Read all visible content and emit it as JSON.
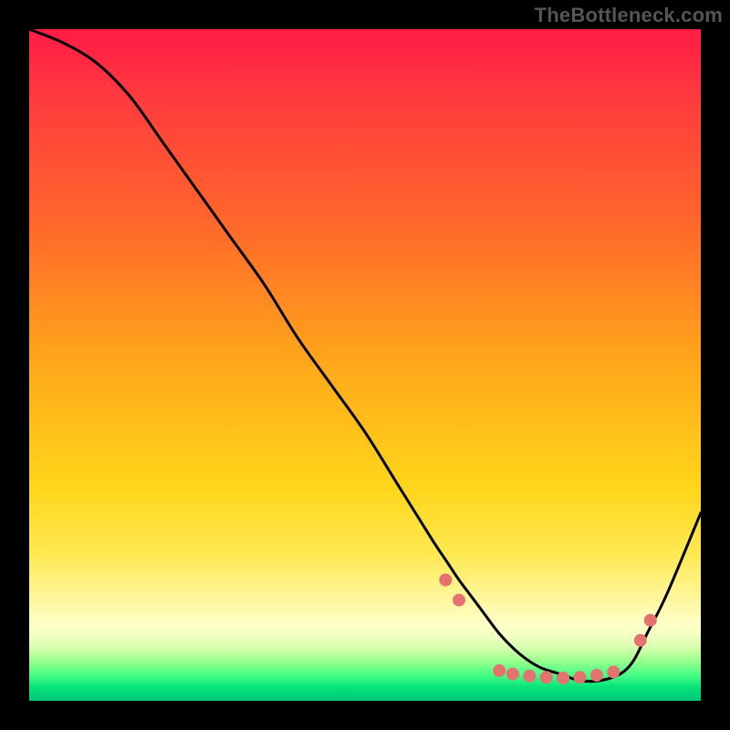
{
  "watermark": "TheBottleneck.com",
  "chart_data": {
    "type": "line",
    "title": "",
    "xlabel": "",
    "ylabel": "",
    "xlim": [
      0,
      100
    ],
    "ylim": [
      0,
      100
    ],
    "series": [
      {
        "name": "curve",
        "x": [
          0,
          5,
          10,
          15,
          20,
          25,
          30,
          35,
          40,
          45,
          50,
          55,
          60,
          62,
          64,
          67,
          70,
          73,
          76,
          79,
          82,
          85,
          88,
          90,
          92,
          95,
          100
        ],
        "y": [
          100,
          98,
          95,
          90,
          83,
          76,
          69,
          62,
          54,
          47,
          40,
          32,
          24,
          21,
          18,
          14,
          10,
          7,
          5,
          4,
          3,
          3,
          4,
          6,
          10,
          16,
          28
        ]
      }
    ],
    "markers": {
      "name": "dots",
      "x": [
        62,
        64,
        70,
        72,
        74.5,
        77,
        79.5,
        82,
        84.5,
        87,
        91,
        92.5
      ],
      "y": [
        18,
        15,
        4.5,
        4,
        3.7,
        3.5,
        3.4,
        3.5,
        3.8,
        4.3,
        9,
        12
      ]
    },
    "colors": {
      "curve": "#000000",
      "markers": "#e4736f",
      "gradient_top": "#ff1c47",
      "gradient_mid": "#ffd51a",
      "gradient_bottom": "#00c877"
    }
  }
}
